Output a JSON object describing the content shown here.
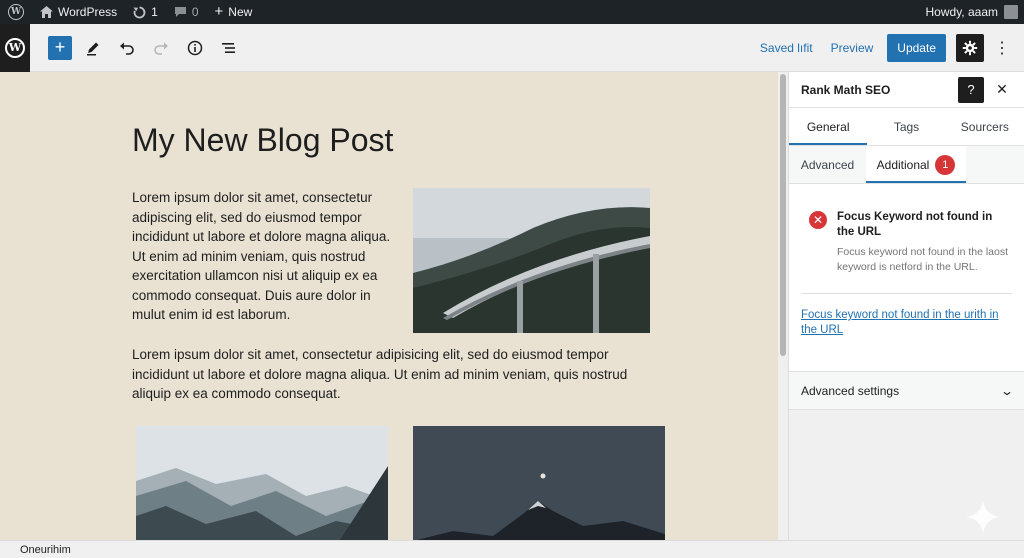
{
  "admin_bar": {
    "site_name": "WordPress",
    "updates_count": "1",
    "comments_count": "0",
    "new_label": "New",
    "howdy": "Howdy, aaam"
  },
  "toolbar": {
    "saved_label": "Saved lıfit",
    "preview_label": "Preview",
    "update_label": "Update"
  },
  "post": {
    "title": "My New Blog Post",
    "paragraph_1": "Lorem ipsum dolor sit amet, consectetur adipiscing elit, sed do eiusmod tempor incididunt ut labore et dolore magna aliqua. Ut enim ad minim veniam, quis nostrud exercitation ullamcon nisi ut aliquip ex ea commodo consequat. Duis aure dolor in mulut enim id est laborum.",
    "paragraph_2": "Lorem ipsum dolor sit amet, consectetur adipisicing elit, sed do eiusmod tempor incididunt ut labore et dolore magna aliqua. Ut enim ad minim veniam, quis nostrud aliquip ex ea commodo consequat."
  },
  "sidebar": {
    "title": "Rank Math SEO",
    "help_label": "?",
    "tabs": [
      {
        "label": "General"
      },
      {
        "label": "Tags"
      },
      {
        "label": "Sourcers"
      }
    ],
    "subtabs": [
      {
        "label": "Advanced"
      },
      {
        "label": "Additional",
        "badge": "1"
      }
    ],
    "check": {
      "title": "Focus Keyword not found in the URL",
      "description": "Focus keyword not found in the laost keyword is netford in the URL."
    },
    "link_text": "Focus keyword not found in the urith in the URL",
    "advanced_settings": "Advanced settings"
  },
  "footer": {
    "breadcrumb": "Oneurihim"
  },
  "colors": {
    "accent": "#2271b1",
    "error": "#d63638",
    "admin_bar": "#1d2327",
    "canvas_bg": "#e9e2d3"
  },
  "icons": {
    "wp_logo": "wordpress-logo-icon",
    "settings": "gear-icon",
    "help": "question-icon",
    "close": "close-icon",
    "error": "error-x-icon"
  }
}
